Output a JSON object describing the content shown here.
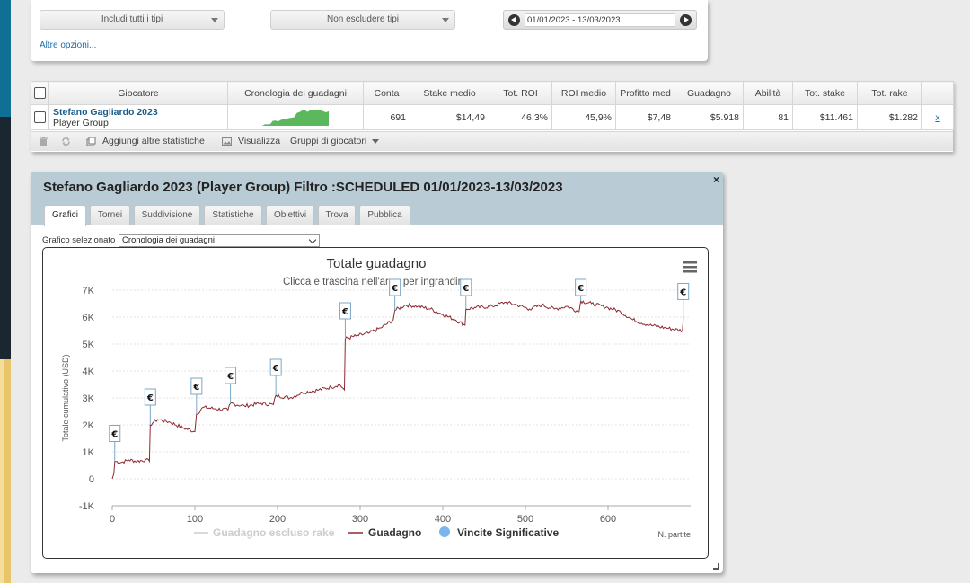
{
  "filters": {
    "include_types": "Includi tutti i tipi",
    "exclude_types": "Non escludere tipi",
    "date_range": "01/01/2023 - 13/03/2023",
    "more_options": "Altre opzioni..."
  },
  "stats_table": {
    "columns": [
      "Giocatore",
      "Cronologia dei guadagni",
      "Conta",
      "Stake medio",
      "Tot. ROI",
      "ROI medio",
      "Profitto med",
      "Guadagno",
      "Abilità",
      "Tot. stake",
      "Tot. rake"
    ],
    "row": {
      "player_name": "Stefano Gagliardo 2023",
      "player_group": "Player Group",
      "conta": "691",
      "stake_medio": "$14,49",
      "tot_roi": "46,3%",
      "roi_medio": "45,9%",
      "profitto_medio": "$7,48",
      "guadagno": "$5.918",
      "abilita": "81",
      "tot_stake": "$11.461",
      "tot_rake": "$1.282",
      "remove": "x"
    }
  },
  "toolbar": {
    "add_stats": "Aggiungi altre statistiche",
    "visualize": "Visualizza",
    "player_groups": "Gruppi di giocatori"
  },
  "report": {
    "title": "Stefano Gagliardo 2023 (Player Group) Filtro :SCHEDULED 01/01/2023-13/03/2023",
    "close": "×",
    "tabs": [
      "Grafici",
      "Tornei",
      "Suddivisione",
      "Statistiche",
      "Obiettivi",
      "Trova",
      "Pubblica"
    ],
    "selected_chart_label": "Grafico selezionato",
    "selected_chart": "Cronologia dei guadagni"
  },
  "colors": {
    "profit_line": "#8b2a30",
    "sparkline": "#5cb85c",
    "significant_wins": "#7cb5ec",
    "excluded_rake": "#cccccc"
  },
  "chart_data": {
    "type": "line",
    "title": "Totale guadagno",
    "subtitle": "Clicca e trascina nell'area per ingrandire.",
    "xlabel": "N. partite",
    "ylabel": "Totale cumulativo (USD)",
    "xlim": [
      0,
      700
    ],
    "ylim": [
      -1000,
      7000
    ],
    "x_ticks": [
      "0",
      "100",
      "200",
      "300",
      "400",
      "500",
      "600"
    ],
    "y_ticks": [
      "-1K",
      "0",
      "1K",
      "2K",
      "3K",
      "4K",
      "5K",
      "6K",
      "7K"
    ],
    "series": [
      {
        "name": "Guadagno escluso rake",
        "visible": false,
        "values": []
      },
      {
        "name": "Guadagno",
        "points": [
          [
            0,
            0
          ],
          [
            2,
            200
          ],
          [
            3,
            650
          ],
          [
            10,
            600
          ],
          [
            20,
            700
          ],
          [
            30,
            650
          ],
          [
            40,
            700
          ],
          [
            45,
            650
          ],
          [
            46,
            2000
          ],
          [
            50,
            2100
          ],
          [
            55,
            2200
          ],
          [
            70,
            2100
          ],
          [
            85,
            1900
          ],
          [
            100,
            1750
          ],
          [
            102,
            2400
          ],
          [
            110,
            2650
          ],
          [
            125,
            2600
          ],
          [
            140,
            2550
          ],
          [
            143,
            2800
          ],
          [
            160,
            2700
          ],
          [
            180,
            2800
          ],
          [
            195,
            2750
          ],
          [
            198,
            3100
          ],
          [
            215,
            3000
          ],
          [
            230,
            3200
          ],
          [
            250,
            3300
          ],
          [
            265,
            3400
          ],
          [
            275,
            3500
          ],
          [
            281,
            3300
          ],
          [
            282,
            5200
          ],
          [
            295,
            5300
          ],
          [
            310,
            5400
          ],
          [
            325,
            5600
          ],
          [
            340,
            5900
          ],
          [
            342,
            6250
          ],
          [
            355,
            6450
          ],
          [
            370,
            6400
          ],
          [
            385,
            6300
          ],
          [
            400,
            6100
          ],
          [
            415,
            5900
          ],
          [
            427,
            5700
          ],
          [
            428,
            6300
          ],
          [
            440,
            6350
          ],
          [
            460,
            6400
          ],
          [
            475,
            6550
          ],
          [
            490,
            6450
          ],
          [
            505,
            6300
          ],
          [
            520,
            6450
          ],
          [
            535,
            6300
          ],
          [
            550,
            6400
          ],
          [
            565,
            6200
          ],
          [
            567,
            6600
          ],
          [
            580,
            6500
          ],
          [
            600,
            6350
          ],
          [
            615,
            6200
          ],
          [
            630,
            5900
          ],
          [
            650,
            5700
          ],
          [
            670,
            5600
          ],
          [
            690,
            5500
          ],
          [
            691,
            5918
          ]
        ]
      },
      {
        "name": "Vincite Significative",
        "markers": [
          [
            3,
            650
          ],
          [
            46,
            2000
          ],
          [
            102,
            2400
          ],
          [
            143,
            2800
          ],
          [
            198,
            3100
          ],
          [
            282,
            5200
          ],
          [
            342,
            6250
          ],
          [
            428,
            6300
          ],
          [
            567,
            6600
          ],
          [
            691,
            5918
          ]
        ],
        "marker_symbol": "€"
      }
    ],
    "grid": true,
    "legend": "bottom"
  },
  "sparkline": {
    "values": [
      0,
      650,
      600,
      700,
      2000,
      2100,
      1800,
      2400,
      2700,
      2800,
      3100,
      3300,
      3500,
      5200,
      5600,
      6250,
      6400,
      5700,
      6300,
      6550,
      6300,
      6600,
      6300,
      5900,
      5500,
      5918
    ]
  }
}
